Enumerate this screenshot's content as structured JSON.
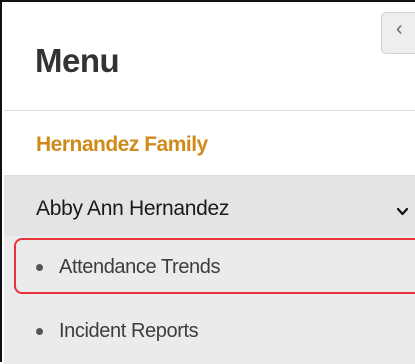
{
  "menu": {
    "title": "Menu",
    "collapse_icon": "chevron-left-icon"
  },
  "family": {
    "name": "Hernandez Family",
    "color": "#d08a1a"
  },
  "student": {
    "name": "Abby Ann Hernandez",
    "expand_icon": "chevron-down-icon",
    "items": [
      {
        "label": "Attendance Trends",
        "highlighted": true
      },
      {
        "label": "Incident Reports",
        "highlighted": false
      }
    ]
  },
  "highlight_color": "#e8323c"
}
